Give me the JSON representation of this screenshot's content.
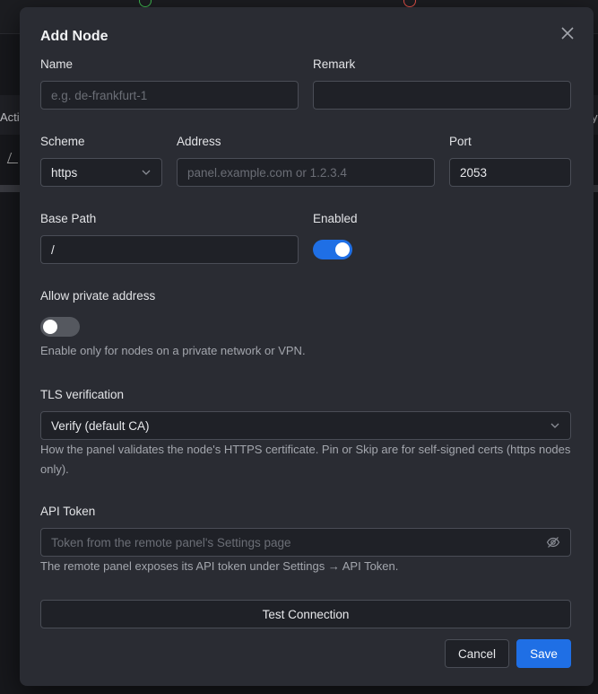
{
  "background": {
    "fragment_left": "Acti",
    "fragment_right": "y"
  },
  "modal": {
    "title": "Add Node",
    "name": {
      "label": "Name",
      "placeholder": "e.g. de-frankfurt-1",
      "value": ""
    },
    "remark": {
      "label": "Remark",
      "value": ""
    },
    "scheme": {
      "label": "Scheme",
      "value": "https"
    },
    "address": {
      "label": "Address",
      "placeholder": "panel.example.com or 1.2.3.4",
      "value": ""
    },
    "port": {
      "label": "Port",
      "value": "2053"
    },
    "base_path": {
      "label": "Base Path",
      "value": "/"
    },
    "enabled": {
      "label": "Enabled",
      "on": true
    },
    "allow_private": {
      "label": "Allow private address",
      "on": false,
      "hint": "Enable only for nodes on a private network or VPN."
    },
    "tls": {
      "label": "TLS verification",
      "value": "Verify (default CA)",
      "hint": "How the panel validates the node's HTTPS certificate. Pin or Skip are for self-signed certs (https nodes only)."
    },
    "api_token": {
      "label": "API Token",
      "placeholder": "Token from the remote panel's Settings page",
      "hint": "The remote panel exposes its API token under Settings → API Token."
    },
    "buttons": {
      "test": "Test Connection",
      "cancel": "Cancel",
      "save": "Save"
    }
  },
  "colors": {
    "accent": "#1f6fe5",
    "modal_bg": "#2a2c33",
    "input_bg": "#1f2127"
  }
}
